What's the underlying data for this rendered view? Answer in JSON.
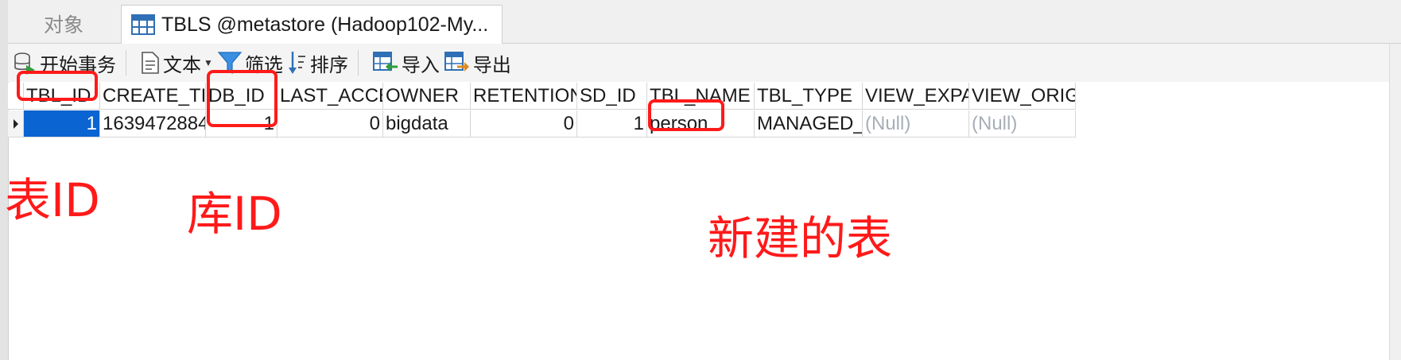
{
  "tabs": {
    "objects_label": "对象",
    "active_label": "TBLS @metastore (Hadoop102-My..."
  },
  "toolbar": {
    "begin_transaction": "开始事务",
    "text": "文本",
    "filter": "筛选",
    "sort": "排序",
    "import": "导入",
    "export": "导出"
  },
  "table": {
    "columns": [
      "TBL_ID",
      "CREATE_TIME",
      "DB_ID",
      "LAST_ACCESS_TIME",
      "OWNER",
      "RETENTION",
      "SD_ID",
      "TBL_NAME",
      "TBL_TYPE",
      "VIEW_EXPANDED_TEXT",
      "VIEW_ORIGINAL_TEXT"
    ],
    "row": [
      "1",
      "1639472884",
      "1",
      "0",
      "bigdata",
      "0",
      "1",
      "person",
      "MANAGED_TABLE",
      "(Null)",
      "(Null)"
    ]
  },
  "annotations": {
    "table_id": "表ID",
    "db_id": "库ID",
    "new_table": "新建的表"
  },
  "colors": {
    "annotation": "#ff1a1a",
    "selection": "#0a64d2",
    "null_text": "#a8aeb6"
  }
}
